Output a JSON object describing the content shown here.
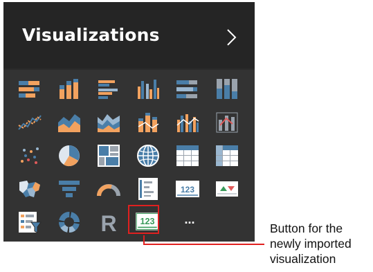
{
  "panel": {
    "title": "Visualizations",
    "expand_icon": "chevron-right-icon"
  },
  "palette": {
    "orange": "#f2a25f",
    "blue": "#4a7ea8",
    "gray": "#9aa3ad",
    "light": "#dfe7ef",
    "red_highlight": "#e0201f"
  },
  "visual_grid": [
    [
      "stacked-bar-chart-icon",
      "stacked-column-chart-icon",
      "clustered-bar-chart-icon",
      "clustered-column-chart-icon",
      "100-stacked-bar-chart-icon",
      "100-stacked-column-chart-icon"
    ],
    [
      "line-chart-icon",
      "area-chart-icon",
      "stacked-area-chart-icon",
      "line-and-stacked-column-chart-icon",
      "line-and-clustered-column-chart-icon",
      "ribbon-chart-icon"
    ],
    [
      "scatter-chart-icon",
      "pie-chart-icon",
      "treemap-icon",
      "map-icon",
      "table-icon",
      "matrix-icon"
    ],
    [
      "filled-map-icon",
      "funnel-icon",
      "gauge-icon",
      "multi-row-card-icon",
      "card-icon",
      "kpi-icon"
    ],
    [
      "slicer-icon",
      "donut-chart-icon",
      "r-script-visual-icon",
      "imported-visual-icon",
      "more-options-icon"
    ]
  ],
  "card_label": "123",
  "r_label": "R",
  "more_label": "...",
  "annotation": {
    "line1": "Button for the",
    "line2": "newly imported",
    "line3": "visualization"
  }
}
